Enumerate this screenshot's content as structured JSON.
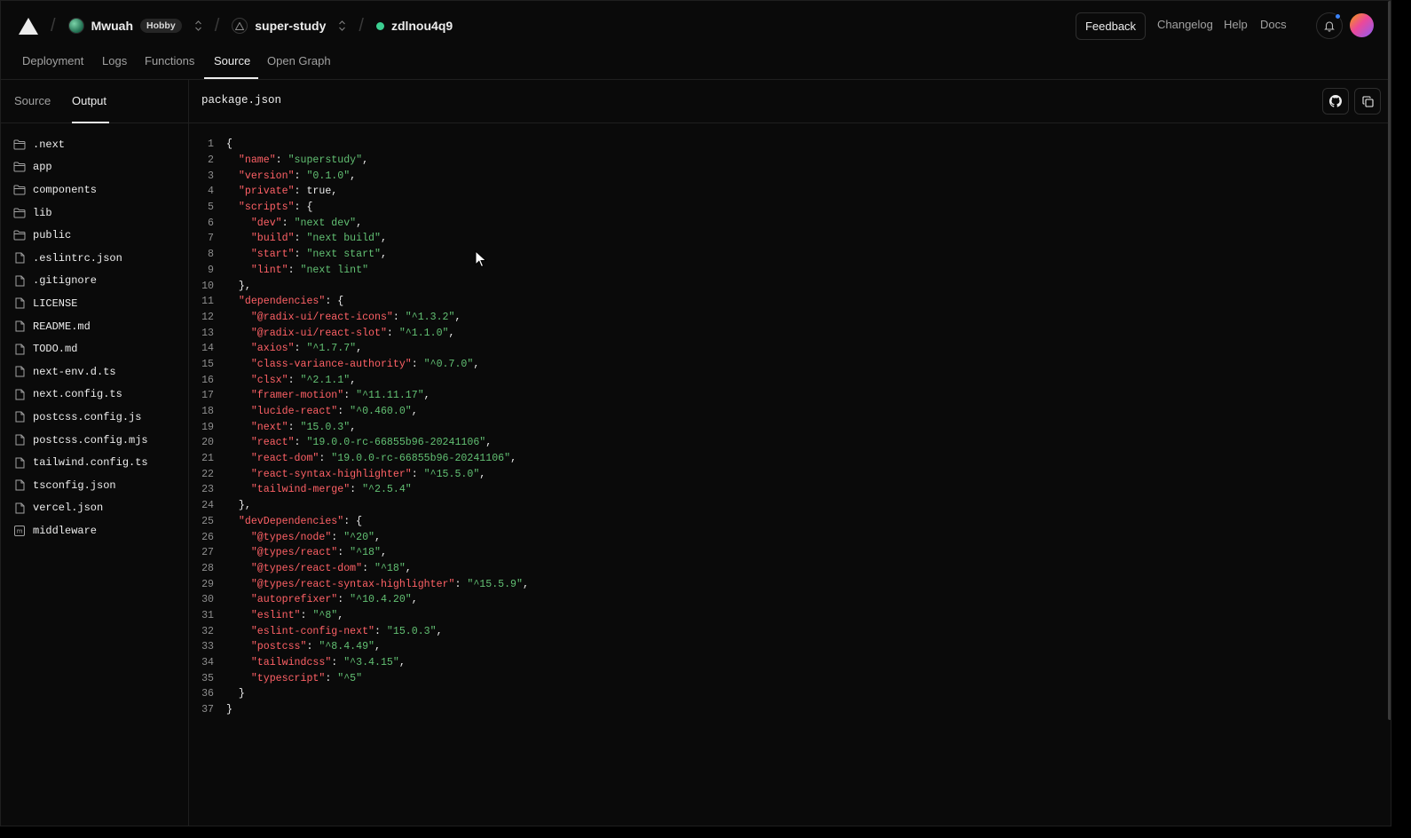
{
  "topbar": {
    "logo_icon": "vercel-triangle-icon",
    "team": {
      "name": "Mwuah",
      "plan": "Hobby"
    },
    "project": {
      "name": "super-study"
    },
    "deployment": {
      "id": "zdlnou4q9",
      "status_color": "#3ccf91"
    },
    "feedback_label": "Feedback",
    "links": [
      "Changelog",
      "Help",
      "Docs"
    ]
  },
  "tabs": {
    "items": [
      "Deployment",
      "Logs",
      "Functions",
      "Source",
      "Open Graph"
    ],
    "active": "Source"
  },
  "sidebar": {
    "tabs": [
      "Source",
      "Output"
    ],
    "active_tab": "Output",
    "files": [
      {
        "name": ".next",
        "type": "folder"
      },
      {
        "name": "app",
        "type": "folder"
      },
      {
        "name": "components",
        "type": "folder"
      },
      {
        "name": "lib",
        "type": "folder"
      },
      {
        "name": "public",
        "type": "folder"
      },
      {
        "name": ".eslintrc.json",
        "type": "file"
      },
      {
        "name": ".gitignore",
        "type": "file"
      },
      {
        "name": "LICENSE",
        "type": "file"
      },
      {
        "name": "README.md",
        "type": "file"
      },
      {
        "name": "TODO.md",
        "type": "file"
      },
      {
        "name": "next-env.d.ts",
        "type": "file"
      },
      {
        "name": "next.config.ts",
        "type": "file"
      },
      {
        "name": "postcss.config.js",
        "type": "file"
      },
      {
        "name": "postcss.config.mjs",
        "type": "file"
      },
      {
        "name": "tailwind.config.ts",
        "type": "file"
      },
      {
        "name": "tsconfig.json",
        "type": "file"
      },
      {
        "name": "vercel.json",
        "type": "file"
      },
      {
        "name": "middleware",
        "type": "function"
      }
    ]
  },
  "viewer": {
    "filename": "package.json",
    "actions": [
      "github-icon",
      "copy-icon"
    ],
    "lines": [
      [
        [
          "p",
          "{"
        ]
      ],
      [
        [
          "p",
          "  "
        ],
        [
          "k",
          "\"name\""
        ],
        [
          "p",
          ": "
        ],
        [
          "s",
          "\"superstudy\""
        ],
        [
          "p",
          ","
        ]
      ],
      [
        [
          "p",
          "  "
        ],
        [
          "k",
          "\"version\""
        ],
        [
          "p",
          ": "
        ],
        [
          "s",
          "\"0.1.0\""
        ],
        [
          "p",
          ","
        ]
      ],
      [
        [
          "p",
          "  "
        ],
        [
          "k",
          "\"private\""
        ],
        [
          "p",
          ": true,"
        ]
      ],
      [
        [
          "p",
          "  "
        ],
        [
          "k",
          "\"scripts\""
        ],
        [
          "p",
          ": {"
        ]
      ],
      [
        [
          "p",
          "    "
        ],
        [
          "k",
          "\"dev\""
        ],
        [
          "p",
          ": "
        ],
        [
          "s",
          "\"next dev\""
        ],
        [
          "p",
          ","
        ]
      ],
      [
        [
          "p",
          "    "
        ],
        [
          "k",
          "\"build\""
        ],
        [
          "p",
          ": "
        ],
        [
          "s",
          "\"next build\""
        ],
        [
          "p",
          ","
        ]
      ],
      [
        [
          "p",
          "    "
        ],
        [
          "k",
          "\"start\""
        ],
        [
          "p",
          ": "
        ],
        [
          "s",
          "\"next start\""
        ],
        [
          "p",
          ","
        ]
      ],
      [
        [
          "p",
          "    "
        ],
        [
          "k",
          "\"lint\""
        ],
        [
          "p",
          ": "
        ],
        [
          "s",
          "\"next lint\""
        ]
      ],
      [
        [
          "p",
          "  },"
        ]
      ],
      [
        [
          "p",
          "  "
        ],
        [
          "k",
          "\"dependencies\""
        ],
        [
          "p",
          ": {"
        ]
      ],
      [
        [
          "p",
          "    "
        ],
        [
          "k",
          "\"@radix-ui/react-icons\""
        ],
        [
          "p",
          ": "
        ],
        [
          "s",
          "\"^1.3.2\""
        ],
        [
          "p",
          ","
        ]
      ],
      [
        [
          "p",
          "    "
        ],
        [
          "k",
          "\"@radix-ui/react-slot\""
        ],
        [
          "p",
          ": "
        ],
        [
          "s",
          "\"^1.1.0\""
        ],
        [
          "p",
          ","
        ]
      ],
      [
        [
          "p",
          "    "
        ],
        [
          "k",
          "\"axios\""
        ],
        [
          "p",
          ": "
        ],
        [
          "s",
          "\"^1.7.7\""
        ],
        [
          "p",
          ","
        ]
      ],
      [
        [
          "p",
          "    "
        ],
        [
          "k",
          "\"class-variance-authority\""
        ],
        [
          "p",
          ": "
        ],
        [
          "s",
          "\"^0.7.0\""
        ],
        [
          "p",
          ","
        ]
      ],
      [
        [
          "p",
          "    "
        ],
        [
          "k",
          "\"clsx\""
        ],
        [
          "p",
          ": "
        ],
        [
          "s",
          "\"^2.1.1\""
        ],
        [
          "p",
          ","
        ]
      ],
      [
        [
          "p",
          "    "
        ],
        [
          "k",
          "\"framer-motion\""
        ],
        [
          "p",
          ": "
        ],
        [
          "s",
          "\"^11.11.17\""
        ],
        [
          "p",
          ","
        ]
      ],
      [
        [
          "p",
          "    "
        ],
        [
          "k",
          "\"lucide-react\""
        ],
        [
          "p",
          ": "
        ],
        [
          "s",
          "\"^0.460.0\""
        ],
        [
          "p",
          ","
        ]
      ],
      [
        [
          "p",
          "    "
        ],
        [
          "k",
          "\"next\""
        ],
        [
          "p",
          ": "
        ],
        [
          "s",
          "\"15.0.3\""
        ],
        [
          "p",
          ","
        ]
      ],
      [
        [
          "p",
          "    "
        ],
        [
          "k",
          "\"react\""
        ],
        [
          "p",
          ": "
        ],
        [
          "s",
          "\"19.0.0-rc-66855b96-20241106\""
        ],
        [
          "p",
          ","
        ]
      ],
      [
        [
          "p",
          "    "
        ],
        [
          "k",
          "\"react-dom\""
        ],
        [
          "p",
          ": "
        ],
        [
          "s",
          "\"19.0.0-rc-66855b96-20241106\""
        ],
        [
          "p",
          ","
        ]
      ],
      [
        [
          "p",
          "    "
        ],
        [
          "k",
          "\"react-syntax-highlighter\""
        ],
        [
          "p",
          ": "
        ],
        [
          "s",
          "\"^15.5.0\""
        ],
        [
          "p",
          ","
        ]
      ],
      [
        [
          "p",
          "    "
        ],
        [
          "k",
          "\"tailwind-merge\""
        ],
        [
          "p",
          ": "
        ],
        [
          "s",
          "\"^2.5.4\""
        ]
      ],
      [
        [
          "p",
          "  },"
        ]
      ],
      [
        [
          "p",
          "  "
        ],
        [
          "k",
          "\"devDependencies\""
        ],
        [
          "p",
          ": {"
        ]
      ],
      [
        [
          "p",
          "    "
        ],
        [
          "k",
          "\"@types/node\""
        ],
        [
          "p",
          ": "
        ],
        [
          "s",
          "\"^20\""
        ],
        [
          "p",
          ","
        ]
      ],
      [
        [
          "p",
          "    "
        ],
        [
          "k",
          "\"@types/react\""
        ],
        [
          "p",
          ": "
        ],
        [
          "s",
          "\"^18\""
        ],
        [
          "p",
          ","
        ]
      ],
      [
        [
          "p",
          "    "
        ],
        [
          "k",
          "\"@types/react-dom\""
        ],
        [
          "p",
          ": "
        ],
        [
          "s",
          "\"^18\""
        ],
        [
          "p",
          ","
        ]
      ],
      [
        [
          "p",
          "    "
        ],
        [
          "k",
          "\"@types/react-syntax-highlighter\""
        ],
        [
          "p",
          ": "
        ],
        [
          "s",
          "\"^15.5.9\""
        ],
        [
          "p",
          ","
        ]
      ],
      [
        [
          "p",
          "    "
        ],
        [
          "k",
          "\"autoprefixer\""
        ],
        [
          "p",
          ": "
        ],
        [
          "s",
          "\"^10.4.20\""
        ],
        [
          "p",
          ","
        ]
      ],
      [
        [
          "p",
          "    "
        ],
        [
          "k",
          "\"eslint\""
        ],
        [
          "p",
          ": "
        ],
        [
          "s",
          "\"^8\""
        ],
        [
          "p",
          ","
        ]
      ],
      [
        [
          "p",
          "    "
        ],
        [
          "k",
          "\"eslint-config-next\""
        ],
        [
          "p",
          ": "
        ],
        [
          "s",
          "\"15.0.3\""
        ],
        [
          "p",
          ","
        ]
      ],
      [
        [
          "p",
          "    "
        ],
        [
          "k",
          "\"postcss\""
        ],
        [
          "p",
          ": "
        ],
        [
          "s",
          "\"^8.4.49\""
        ],
        [
          "p",
          ","
        ]
      ],
      [
        [
          "p",
          "    "
        ],
        [
          "k",
          "\"tailwindcss\""
        ],
        [
          "p",
          ": "
        ],
        [
          "s",
          "\"^3.4.15\""
        ],
        [
          "p",
          ","
        ]
      ],
      [
        [
          "p",
          "    "
        ],
        [
          "k",
          "\"typescript\""
        ],
        [
          "p",
          ": "
        ],
        [
          "s",
          "\"^5\""
        ]
      ],
      [
        [
          "p",
          "  }"
        ]
      ],
      [
        [
          "p",
          "}"
        ]
      ]
    ]
  },
  "colors": {
    "background": "#0a0a0a",
    "border": "#1f1f1f",
    "key": "#ff6166",
    "string": "#62c073",
    "muted_text": "#a1a1a1"
  }
}
